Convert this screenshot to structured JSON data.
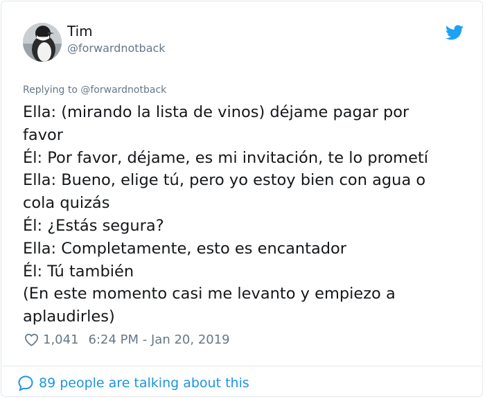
{
  "user": {
    "name": "Tim",
    "handle": "@forwardnotback"
  },
  "tweet": {
    "replying_to": "Replying to @forwardnotback",
    "lines": [
      "Ella: (mirando la lista de vinos) déjame pagar por",
      "favor",
      "Él: Por favor, déjame, es mi invitación, te lo prometí",
      "Ella: Bueno, elige tú, pero yo estoy bien con agua o",
      "cola quizás",
      "Él: ¿Estás segura?",
      "Ella: Completamente, esto es encantador",
      "Él: Tú también",
      "(En este momento casi me levanto y empiezo a",
      "aplaudirles)"
    ],
    "likes": "1,041",
    "timestamp": "6:24 PM - Jan 20, 2019"
  },
  "footer": {
    "talking": "89 people are talking about this"
  },
  "icons": {
    "brand": "twitter-bird-icon",
    "like": "heart-icon",
    "reply": "comment-bubble-icon"
  },
  "colors": {
    "brand_blue": "#1DA1F2",
    "link_blue": "#1B95E0",
    "secondary_text": "#657786",
    "primary_text": "#14171A",
    "border": "#E1E8ED"
  }
}
